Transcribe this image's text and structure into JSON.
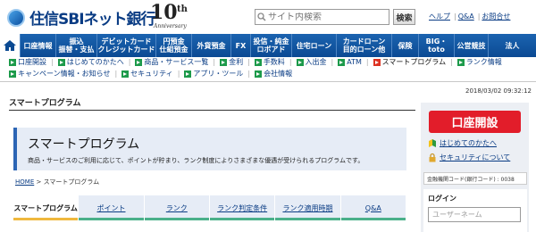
{
  "header": {
    "logo_text": "住信SBIネット銀行",
    "anniversary_number": "10",
    "anniversary_suffix": "th",
    "anniversary_label": "Anniversary",
    "search_placeholder": "サイト内検索",
    "search_button": "検索",
    "links": [
      "ヘルプ",
      "Q&A",
      "お問合せ"
    ]
  },
  "global_nav": [
    {
      "label": "",
      "icon": "home-icon"
    },
    {
      "label": "口座情報"
    },
    {
      "label": "振込\n振替・支払"
    },
    {
      "label": "デビットカード\nクレジットカード"
    },
    {
      "label": "円預金\n仕組預金"
    },
    {
      "label": "外貨預金"
    },
    {
      "label": "FX"
    },
    {
      "label": "投信・純金\nロボアド"
    },
    {
      "label": "住宅ローン"
    },
    {
      "label": "カードローン\n目的ローン他"
    },
    {
      "label": "保険"
    },
    {
      "label": "BIG・toto"
    },
    {
      "label": "公営競技"
    },
    {
      "label": "法人"
    }
  ],
  "sub_nav": {
    "row1": [
      "口座開設",
      "はじめてのかたへ",
      "商品・サービス一覧",
      "金利",
      "手数料",
      "入出金",
      "ATM",
      "スマートプログラム",
      "ランク情報"
    ],
    "row2": [
      "キャンペーン情報・お知らせ",
      "セキュリティ",
      "アプリ・ツール",
      "会社情報"
    ],
    "active": "スマートプログラム"
  },
  "datetime": "2018/03/02 09:32:12",
  "page_title": "スマートプログラム",
  "banner": {
    "title": "スマートプログラム",
    "description": "商品・サービスのご利用に応じて、ポイントが貯まり、ランク制度によりさまざまな優遇が受けられるプログラムです。"
  },
  "breadcrumb": {
    "home": "HOME",
    "separator": ">",
    "current": "スマートプログラム"
  },
  "tabs": [
    "スマートプログラム",
    "ポイント",
    "ランク",
    "ランク判定条件",
    "ランク適用時期",
    "Q&A"
  ],
  "active_tab": "スマートプログラム",
  "sidebar": {
    "open_account": "口座開設",
    "links": [
      {
        "label": "はじめてのかたへ",
        "icon": "beginner-leaf-icon"
      },
      {
        "label": "セキュリティについて",
        "icon": "lock-icon"
      }
    ],
    "bank_code": "金融機関コード(銀行コード) : 0038",
    "login_title": "ログイン",
    "username_placeholder": "ユーザーネーム"
  },
  "colors": {
    "brand": "#0b4a93",
    "accent_red": "#e21d2a",
    "tab_active": "#efb83e",
    "tab_inactive": "#4ab08a"
  }
}
